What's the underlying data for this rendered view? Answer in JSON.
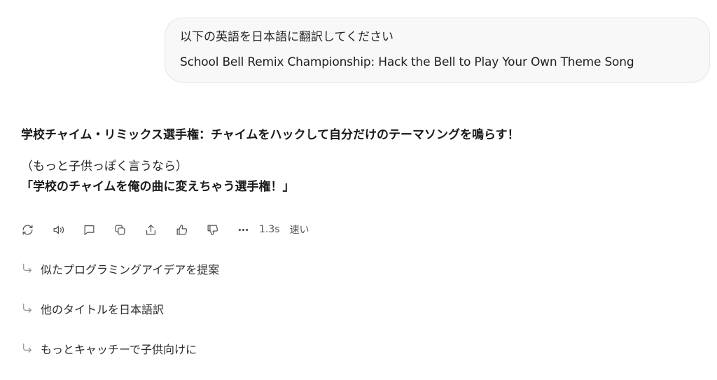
{
  "user_message": {
    "line1": "以下の英語を日本語に翻訳してください",
    "line2": "School Bell Remix Championship: Hack the Bell to Play Your Own Theme Song"
  },
  "response": {
    "title": "学校チャイム・リミックス選手権：チャイムをハックして自分だけのテーマソングを鳴らす！",
    "note": "（もっと子供っぽく言うなら）",
    "quote": "「学校のチャイムを俺の曲に変えちゃう選手権！」"
  },
  "toolbar": {
    "icons": [
      "regenerate-icon",
      "speaker-icon",
      "comment-icon",
      "copy-icon",
      "share-icon",
      "thumbs-up-icon",
      "thumbs-down-icon",
      "more-icon"
    ],
    "time": "1.3s",
    "speed": "速い"
  },
  "suggestions": [
    {
      "label": "似たプログラミングアイデアを提案"
    },
    {
      "label": "他のタイトルを日本語訳"
    },
    {
      "label": "もっとキャッチーで子供向けに"
    }
  ]
}
